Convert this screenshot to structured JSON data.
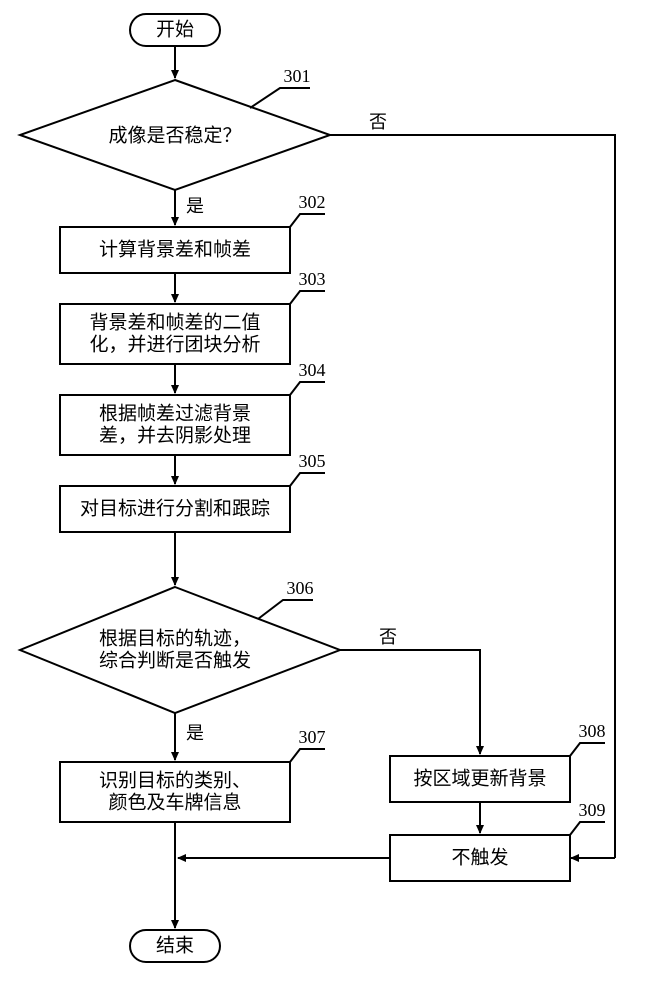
{
  "chart_data": {
    "type": "flowchart",
    "title": "",
    "nodes": [
      {
        "id": "start",
        "type": "terminator",
        "label": "开始"
      },
      {
        "id": "d301",
        "type": "decision",
        "number": "301",
        "label": "成像是否稳定？",
        "yes": "是",
        "no": "否"
      },
      {
        "id": "p302",
        "type": "process",
        "number": "302",
        "label": "计算背景差和帧差"
      },
      {
        "id": "p303",
        "type": "process",
        "number": "303",
        "label": [
          "背景差和帧差的二值",
          "化，并进行团块分析"
        ]
      },
      {
        "id": "p304",
        "type": "process",
        "number": "304",
        "label": [
          "根据帧差过滤背景",
          "差，并去阴影处理"
        ]
      },
      {
        "id": "p305",
        "type": "process",
        "number": "305",
        "label": "对目标进行分割和跟踪"
      },
      {
        "id": "d306",
        "type": "decision",
        "number": "306",
        "label": [
          "根据目标的轨迹，",
          "综合判断是否触发"
        ],
        "yes": "是",
        "no": "否"
      },
      {
        "id": "p307",
        "type": "process",
        "number": "307",
        "label": [
          "识别目标的类别、",
          "颜色及车牌信息"
        ]
      },
      {
        "id": "p308",
        "type": "process",
        "number": "308",
        "label": "按区域更新背景"
      },
      {
        "id": "p309",
        "type": "process",
        "number": "309",
        "label": "不触发"
      },
      {
        "id": "end",
        "type": "terminator",
        "label": "结束"
      }
    ],
    "edges": [
      {
        "from": "start",
        "to": "d301"
      },
      {
        "from": "d301",
        "to": "p302",
        "label": "是"
      },
      {
        "from": "d301",
        "to": "p309",
        "label": "否"
      },
      {
        "from": "p302",
        "to": "p303"
      },
      {
        "from": "p303",
        "to": "p304"
      },
      {
        "from": "p304",
        "to": "p305"
      },
      {
        "from": "p305",
        "to": "d306"
      },
      {
        "from": "d306",
        "to": "p307",
        "label": "是"
      },
      {
        "from": "d306",
        "to": "p308",
        "label": "否"
      },
      {
        "from": "p308",
        "to": "p309"
      },
      {
        "from": "p307",
        "to": "end"
      },
      {
        "from": "p309",
        "to": "end"
      }
    ]
  },
  "start": "开始",
  "end": "结束",
  "yes": "是",
  "no": "否",
  "n301": "301",
  "n302": "302",
  "n303": "303",
  "n304": "304",
  "n305": "305",
  "n306": "306",
  "n307": "307",
  "n308": "308",
  "n309": "309",
  "t301": "成像是否稳定？",
  "t302": "计算背景差和帧差",
  "t303a": "背景差和帧差的二值",
  "t303b": "化，并进行团块分析",
  "t304a": "根据帧差过滤背景",
  "t304b": "差，并去阴影处理",
  "t305": "对目标进行分割和跟踪",
  "t306a": "根据目标的轨迹，",
  "t306b": "综合判断是否触发",
  "t307a": "识别目标的类别、",
  "t307b": "颜色及车牌信息",
  "t308": "按区域更新背景",
  "t309": "不触发"
}
